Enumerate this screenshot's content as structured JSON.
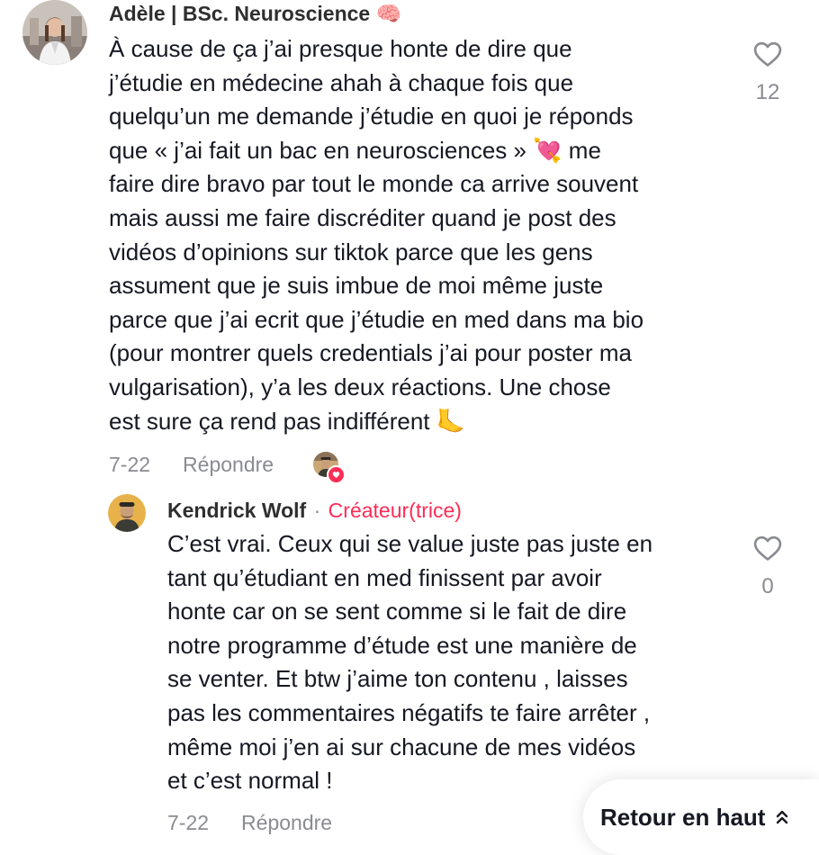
{
  "comments": [
    {
      "username": "Adèle | BSc. Neuroscience 🧠",
      "text": "À cause de ça j’ai presque honte de dire que\nj’étudie en médecine ahah à chaque fois que\nquelqu’un me demande j’étudie en quoi je réponds\nque « j’ai fait un bac en neurosciences » 💘 me\nfaire dire bravo par tout le monde ca arrive souvent\nmais aussi me faire discréditer quand je post des\nvidéos d’opinions sur tiktok parce que les gens\nassument que je suis imbue de moi même juste\nparce que j’ai ecrit que j’étudie en med dans ma bio\n(pour montrer quels credentials j’ai pour poster ma\nvulgarisation), y’a les deux réactions. Une chose\nest sure ça rend pas indifférent 🦶",
      "date": "7-22",
      "reply_label": "Répondre",
      "like_count": "12",
      "liked_by_creator": true
    },
    {
      "username": "Kendrick Wolf",
      "separator": "·",
      "creator_label": "Créateur(trice)",
      "text": "C’est vrai. Ceux qui se value juste pas juste en\ntant qu’étudiant en med finissent par avoir\nhonte car on se sent comme si le fait de dire\nnotre programme d’étude est une manière de\nse venter. Et btw j’aime ton contenu , laisses\npas les commentaires négatifs te faire arrêter ,\nmême moi j’en ai sur chacune de mes vidéos\net c’est normal !",
      "date": "7-22",
      "reply_label": "Répondre",
      "like_count": "0"
    }
  ],
  "back_to_top": {
    "label": "Retour en haut",
    "icon": "double-chevron-up-icon"
  },
  "colors": {
    "accent": "#fe2c55",
    "text": "#161823",
    "muted": "#8a8b91"
  }
}
